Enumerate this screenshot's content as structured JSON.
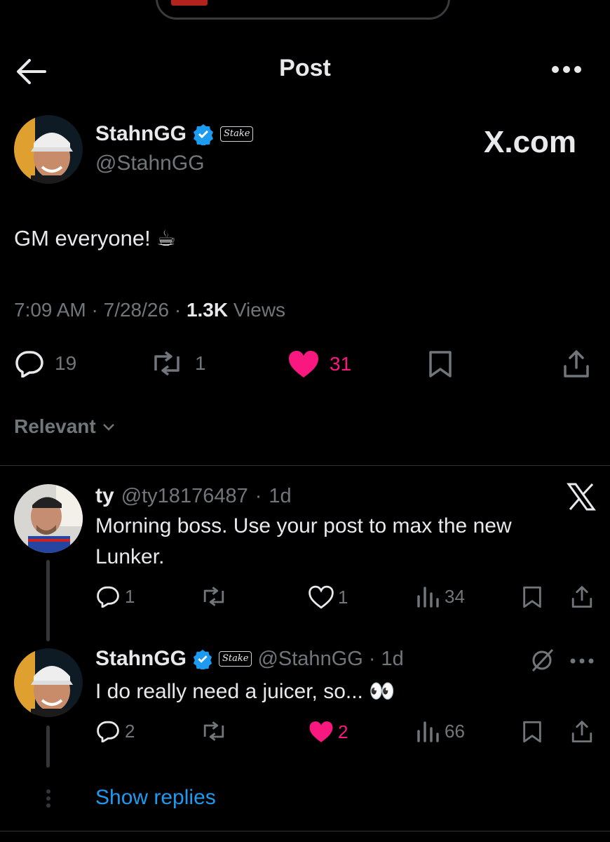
{
  "nav": {
    "title": "Post"
  },
  "watermark": "X.com",
  "post": {
    "author_name": "StahnGG",
    "author_handle": "@StahnGG",
    "affiliate_badge": "Stake",
    "text": "GM everyone! ☕",
    "time": "7:09 AM",
    "date": "7/28/26",
    "views_count": "1.3K",
    "views_label": "Views",
    "replies": "19",
    "reposts": "1",
    "likes": "31",
    "liked": true
  },
  "sort": {
    "label": "Relevant"
  },
  "replies": [
    {
      "author_name": "ty",
      "author_handle": "@ty18176487",
      "time": "1d",
      "text": "Morning boss. Use your post to max the new Lunker.",
      "replies": "1",
      "reposts": "",
      "likes": "1",
      "liked": false,
      "views": "34"
    },
    {
      "author_name": "StahnGG",
      "author_handle": "@StahnGG",
      "affiliate_badge": "Stake",
      "time": "1d",
      "text": "I do really need a juicer, so... 👀",
      "replies": "2",
      "reposts": "",
      "likes": "2",
      "liked": true,
      "views": "66"
    }
  ],
  "show_replies": "Show replies",
  "colors": {
    "background": "#000000",
    "like": "#f91880",
    "verified": "#1d9bf0",
    "muted": "#71767b"
  }
}
